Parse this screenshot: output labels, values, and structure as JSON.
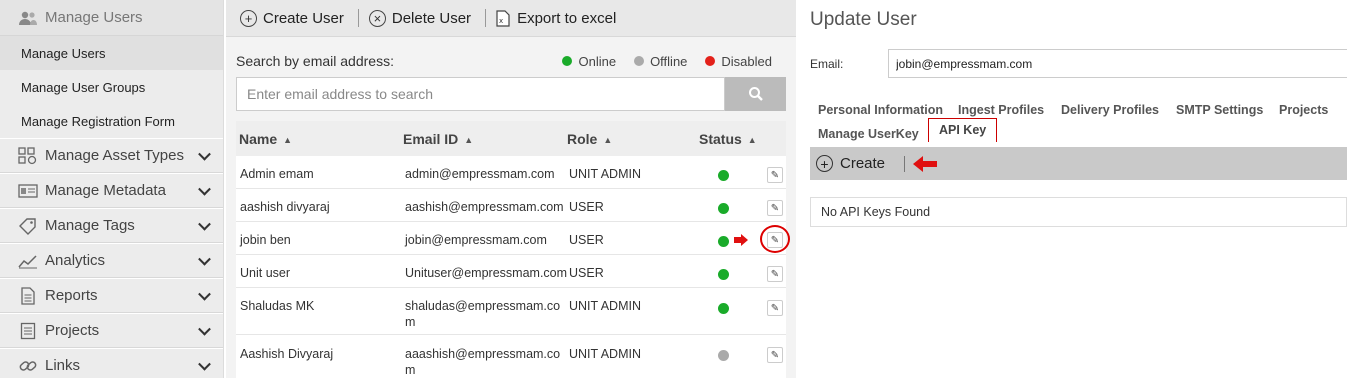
{
  "sidebar": {
    "header": {
      "label": "Manage Users",
      "icon": "users-icon"
    },
    "sub_items": [
      {
        "label": "Manage Users"
      },
      {
        "label": "Manage User Groups"
      },
      {
        "label": "Manage Registration Form"
      }
    ],
    "items": [
      {
        "label": "Manage Asset Types",
        "icon": "asset-types-icon"
      },
      {
        "label": "Manage Metadata",
        "icon": "metadata-icon"
      },
      {
        "label": "Manage Tags",
        "icon": "tag-icon"
      },
      {
        "label": "Analytics",
        "icon": "analytics-icon"
      },
      {
        "label": "Reports",
        "icon": "reports-icon"
      },
      {
        "label": "Projects",
        "icon": "projects-icon"
      },
      {
        "label": "Links",
        "icon": "links-icon"
      }
    ]
  },
  "toolbar": {
    "create_label": "Create User",
    "delete_label": "Delete User",
    "export_label": "Export to excel"
  },
  "search": {
    "label": "Search by email address:",
    "placeholder": "Enter email address to search"
  },
  "legend": {
    "online": "Online",
    "offline": "Offline",
    "disabled": "Disabled",
    "colors": {
      "online": "#1aab2a",
      "offline": "#aaaaaa",
      "disabled": "#e3211a"
    }
  },
  "table": {
    "headers": {
      "name": "Name",
      "email": "Email ID",
      "role": "Role",
      "status": "Status"
    },
    "rows": [
      {
        "name": "Admin emam",
        "email": "admin@empressmam.com",
        "role": "UNIT ADMIN",
        "status": "online"
      },
      {
        "name": "aashish divyaraj",
        "email": "aashish@empressmam.com",
        "role": "USER",
        "status": "online"
      },
      {
        "name": "jobin ben",
        "email": "jobin@empressmam.com",
        "role": "USER",
        "status": "online"
      },
      {
        "name": "Unit user",
        "email": "Unituser@empressmam.com",
        "role": "USER",
        "status": "online"
      },
      {
        "name": "Shaludas MK",
        "email": "shaludas@empressmam.co",
        "email_wrap": "m",
        "role": "UNIT ADMIN",
        "status": "online"
      },
      {
        "name": "Aashish Divyaraj",
        "email": "aaashish@empressmam.co",
        "email_wrap": "m",
        "role": "UNIT ADMIN",
        "status": "offline"
      }
    ]
  },
  "update_user": {
    "title": "Update User",
    "email_label": "Email:",
    "email_value": "jobin@empressmam.com",
    "tabs": [
      "Personal Information",
      "Ingest Profiles",
      "Delivery Profiles",
      "SMTP Settings",
      "Projects",
      "Manage UserKey",
      "API Key"
    ],
    "active_tab": "API Key",
    "create_label": "Create",
    "empty_message": "No API Keys Found"
  }
}
